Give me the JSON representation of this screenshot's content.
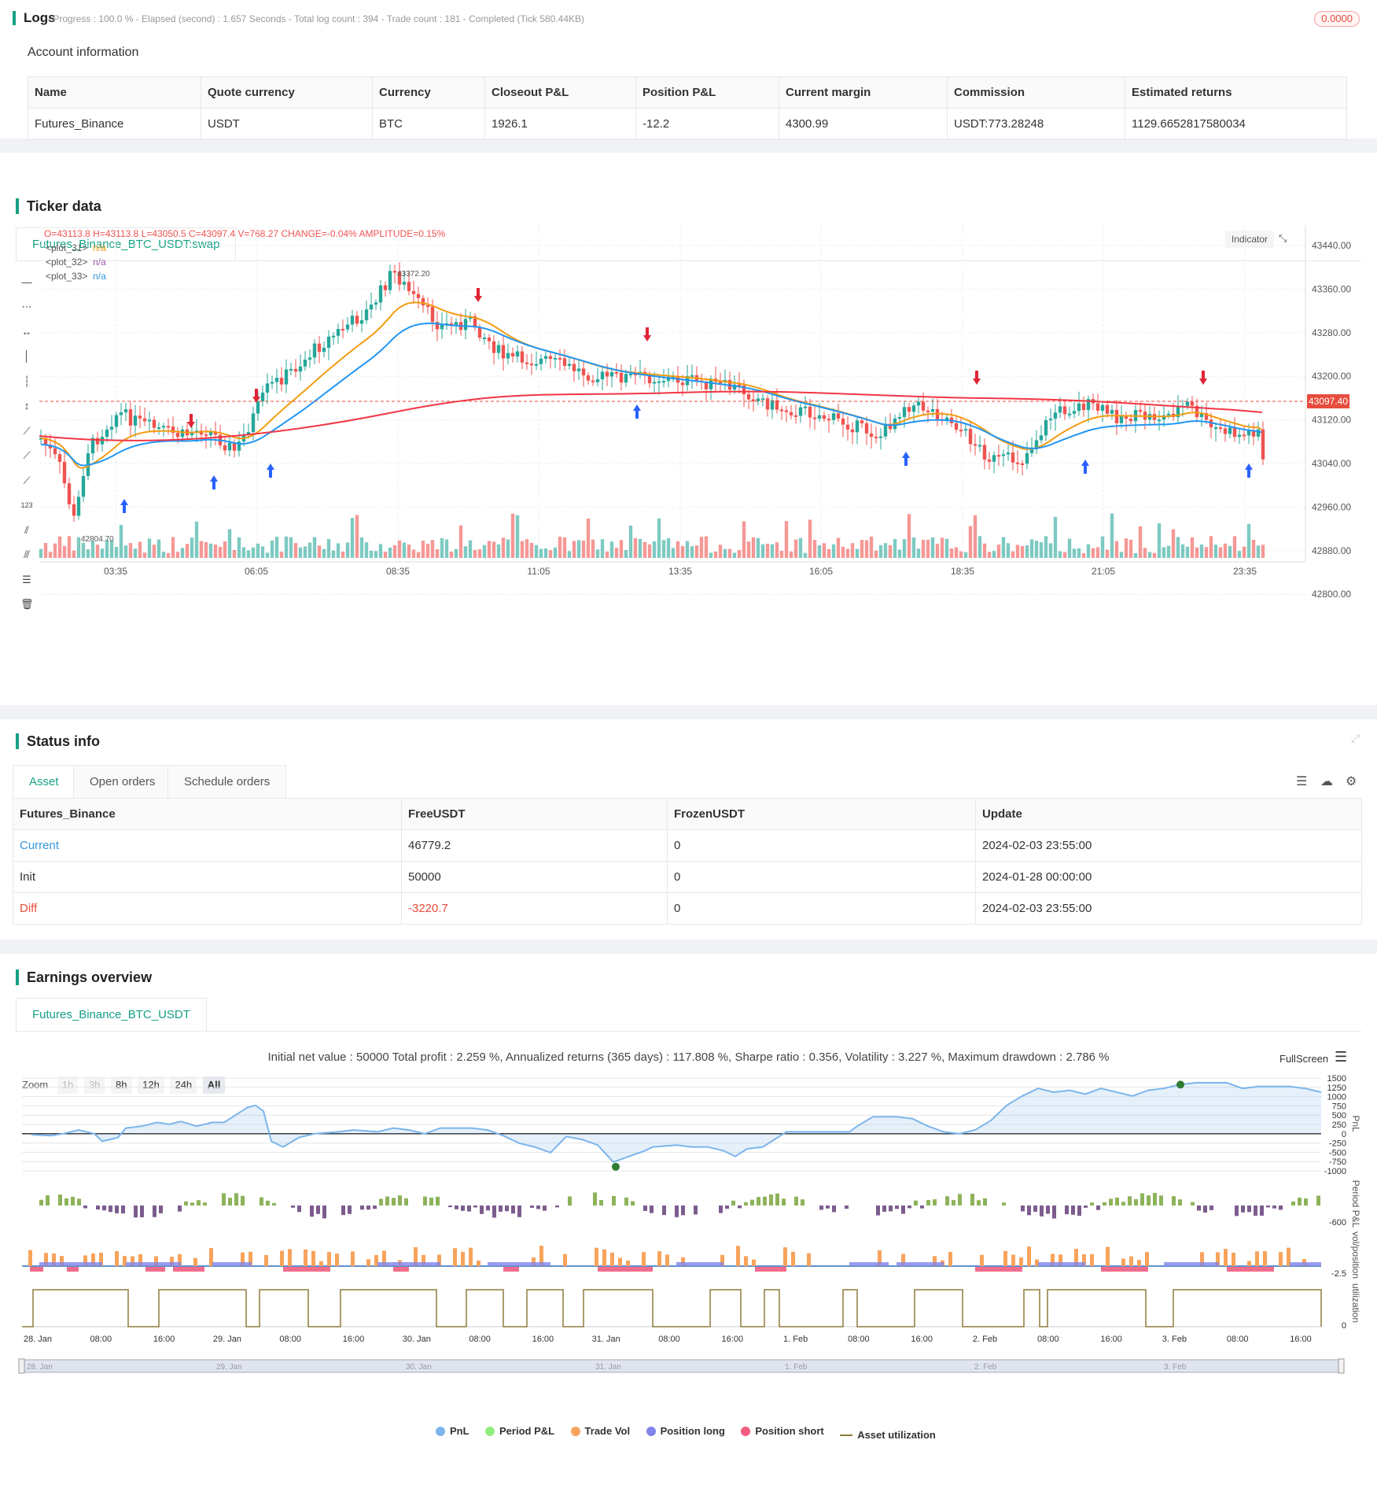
{
  "logs": {
    "title": "Logs",
    "status": "- Progress : 100.0 % - Elapsed (second) : 1.657 Seconds - Total log count : 394 - Trade count : 181 - Completed (Tick 580.44KB)",
    "badge": "0.0000"
  },
  "account": {
    "title": "Account information",
    "headers": [
      "Name",
      "Quote currency",
      "Currency",
      "Closeout P&L",
      "Position P&L",
      "Current margin",
      "Commission",
      "Estimated returns"
    ],
    "row": [
      "Futures_Binance",
      "USDT",
      "BTC",
      "1926.1",
      "-12.2",
      "4300.99",
      "USDT:773.28248",
      "1129.6652817580034"
    ]
  },
  "ticker": {
    "title": "Ticker data",
    "tab": "Futures_Binance_BTC_USDT:swap",
    "ohlc": "O=43113.8 H=43113.8 L=43050.5 C=43097.4 V=768.27 CHANGE=-0.04% AMPLITUDE=0.15%",
    "plots": [
      {
        "name": "<plot_31>",
        "value": "n/a",
        "color": "#f39c12"
      },
      {
        "name": "<plot_32>",
        "value": "n/a",
        "color": "#9b59b6"
      },
      {
        "name": "<plot_33>",
        "value": "n/a",
        "color": "#3498db"
      }
    ],
    "indicator_btn": "Indicator",
    "price_label": "43097.40",
    "high_label": "43372.20",
    "low_label": "42804.70",
    "y_ticks": [
      "43440.00",
      "43360.00",
      "43280.00",
      "43200.00",
      "43120.00",
      "43040.00",
      "42960.00",
      "42880.00",
      "42800.00"
    ],
    "x_ticks": [
      "03:35",
      "06:05",
      "08:35",
      "11:05",
      "13:35",
      "16:05",
      "18:35",
      "21:05",
      "23:35"
    ],
    "colors": {
      "up": "#26a69a",
      "down": "#ef5350",
      "ma_red": "#f23645",
      "ma_orange": "#f39c12",
      "ma_blue": "#2196f3"
    }
  },
  "status": {
    "title": "Status info",
    "tabs": [
      "Asset",
      "Open orders",
      "Schedule orders"
    ],
    "headers": [
      "Futures_Binance",
      "FreeUSDT",
      "FrozenUSDT",
      "Update"
    ],
    "rows": [
      [
        "Current",
        "46779.2",
        "0",
        "2024-02-03 23:55:00"
      ],
      [
        "Init",
        "50000",
        "0",
        "2024-01-28 00:00:00"
      ],
      [
        "Diff",
        "-3220.7",
        "0",
        "2024-02-03 23:55:00"
      ]
    ]
  },
  "earnings": {
    "title": "Earnings overview",
    "tab": "Futures_Binance_BTC_USDT",
    "summary": "Initial net value : 50000 Total profit : 2.259 %, Annualized returns (365 days) : 117.808 %, Sharpe ratio : 0.356, Volatility : 3.227 %, Maximum drawdown : 2.786 %",
    "fullscreen": "FullScreen",
    "zoom_label": "Zoom",
    "zoom_buttons": [
      "1h",
      "3h",
      "8h",
      "12h",
      "24h",
      "All"
    ],
    "pnl_ticks": [
      "1500",
      "1250",
      "1000",
      "750",
      "500",
      "250",
      "0",
      "-250",
      "-500",
      "-750",
      "-1000"
    ],
    "axis_titles": [
      "PnL",
      "Period P&L",
      "vol/position",
      "utilization"
    ],
    "period_tick": "-600",
    "vol_tick": "-2.5",
    "util_tick": "0",
    "x_ticks": [
      "28. Jan",
      "08:00",
      "16:00",
      "29. Jan",
      "08:00",
      "16:00",
      "30. Jan",
      "08:00",
      "16:00",
      "31. Jan",
      "08:00",
      "16:00",
      "1. Feb",
      "08:00",
      "16:00",
      "2. Feb",
      "08:00",
      "16:00",
      "3. Feb",
      "08:00",
      "16:00"
    ],
    "nav_ticks": [
      "28. Jan",
      "29. Jan",
      "30. Jan",
      "31. Jan",
      "1. Feb",
      "2. Feb",
      "3. Feb"
    ],
    "legend": [
      {
        "label": "PnL",
        "color": "#7cb5ec"
      },
      {
        "label": "Period P&L",
        "color": "#90ed7d"
      },
      {
        "label": "Trade Vol",
        "color": "#f7a35c"
      },
      {
        "label": "Position long",
        "color": "#8085e9"
      },
      {
        "label": "Position short",
        "color": "#f15c80"
      },
      {
        "label": "Asset utilization",
        "color": "#8d7b3c"
      }
    ]
  }
}
